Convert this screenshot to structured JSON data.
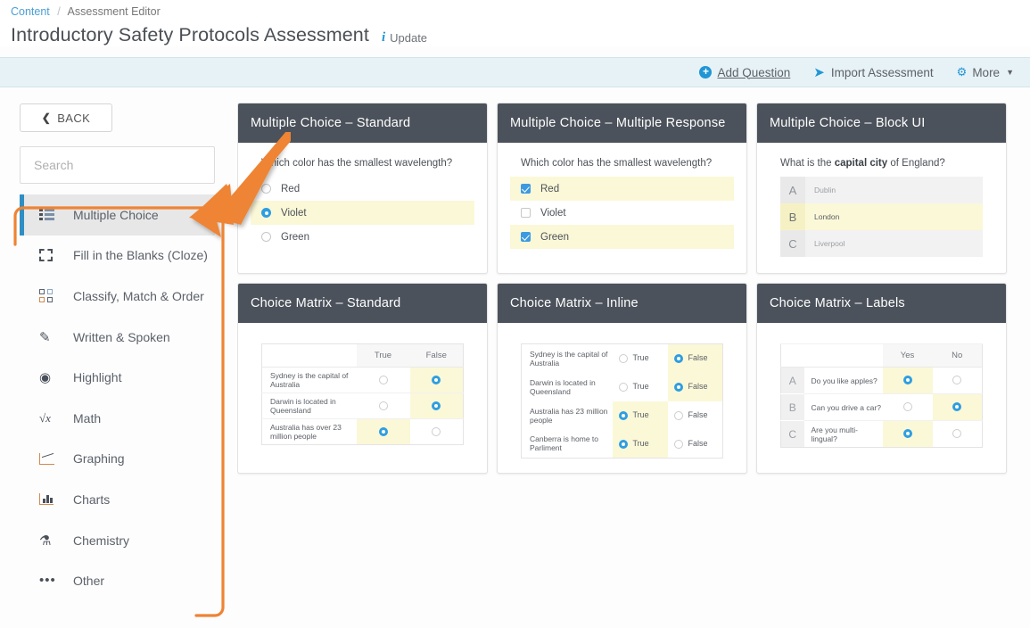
{
  "breadcrumb": {
    "root": "Content",
    "separator": "/",
    "current": "Assessment Editor"
  },
  "header": {
    "title": "Introductory Safety Protocols Assessment",
    "update_label": "Update",
    "info_icon": "info-icon"
  },
  "toolbar": {
    "add_question": "Add Question",
    "import_assessment": "Import Assessment",
    "more": "More",
    "accent_color": "#2196d4",
    "background_color": "#e7f2f7"
  },
  "sidebar": {
    "back_label": "BACK",
    "search_placeholder": "Search",
    "search_value": "",
    "items": [
      {
        "label": "Multiple Choice",
        "icon": "list-icon",
        "active": true
      },
      {
        "label": "Fill in the Blanks (Cloze)",
        "icon": "dashed-box-icon",
        "active": false
      },
      {
        "label": "Classify, Match & Order",
        "icon": "grid-icon",
        "active": false
      },
      {
        "label": "Written & Spoken",
        "icon": "pencil-icon",
        "active": false
      },
      {
        "label": "Highlight",
        "icon": "target-icon",
        "active": false
      },
      {
        "label": "Math",
        "icon": "sqrt-icon",
        "active": false
      },
      {
        "label": "Graphing",
        "icon": "line-chart-icon",
        "active": false
      },
      {
        "label": "Charts",
        "icon": "bar-chart-icon",
        "active": false
      },
      {
        "label": "Chemistry",
        "icon": "flask-icon",
        "active": false
      },
      {
        "label": "Other",
        "icon": "ellipsis-icon",
        "active": false
      }
    ],
    "annotation_color": "#ef8b3c",
    "active_marker_color": "#2f8fc4"
  },
  "cards": {
    "mc_standard": {
      "title": "Multiple Choice – Standard",
      "question": "Which color has the smallest wavelength?",
      "options": [
        {
          "label": "Red",
          "selected": false
        },
        {
          "label": "Violet",
          "selected": true
        },
        {
          "label": "Green",
          "selected": false
        }
      ]
    },
    "mc_multiple_response": {
      "title": "Multiple Choice – Multiple Response",
      "question": "Which color has the smallest wavelength?",
      "options": [
        {
          "label": "Red",
          "selected": true
        },
        {
          "label": "Violet",
          "selected": false
        },
        {
          "label": "Green",
          "selected": true
        }
      ]
    },
    "mc_block_ui": {
      "title": "Multiple Choice – Block UI",
      "question_prefix": "What is the ",
      "question_bold": "capital city",
      "question_suffix": " of England?",
      "options": [
        {
          "letter": "A",
          "label": "Dublin",
          "selected": false
        },
        {
          "letter": "B",
          "label": "London",
          "selected": true
        },
        {
          "letter": "C",
          "label": "Liverpool",
          "selected": false
        }
      ]
    },
    "matrix_standard": {
      "title": "Choice Matrix – Standard",
      "columns": [
        "True",
        "False"
      ],
      "rows": [
        {
          "text": "Sydney is the capital of Australia",
          "selected": 1
        },
        {
          "text": "Darwin is located in Queensland",
          "selected": 1
        },
        {
          "text": "Australia has over 23 million people",
          "selected": 0
        }
      ]
    },
    "matrix_inline": {
      "title": "Choice Matrix – Inline",
      "columns": [
        "True",
        "False"
      ],
      "rows": [
        {
          "text": "Sydney is the capital of Australia",
          "selected": 1
        },
        {
          "text": "Darwin is located in Queensland",
          "selected": 1
        },
        {
          "text": "Australia has 23 million people",
          "selected": 0
        },
        {
          "text": "Canberra is home to Parliment",
          "selected": 0
        }
      ]
    },
    "matrix_labels": {
      "title": "Choice Matrix – Labels",
      "columns": [
        "Yes",
        "No"
      ],
      "rows": [
        {
          "letter": "A",
          "text": "Do you like apples?",
          "selected": 0
        },
        {
          "letter": "B",
          "text": "Can you drive a car?",
          "selected": 1
        },
        {
          "letter": "C",
          "text": "Are you multi-lingual?",
          "selected": 0
        }
      ]
    }
  }
}
